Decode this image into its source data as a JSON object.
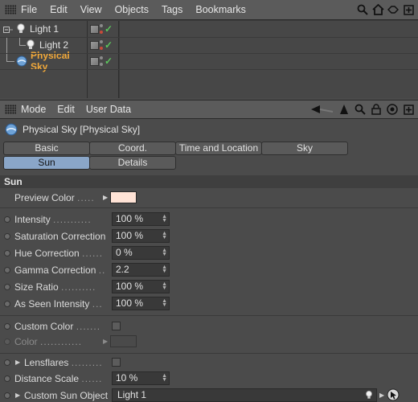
{
  "object_manager": {
    "menu": [
      "File",
      "Edit",
      "View",
      "Objects",
      "Tags",
      "Bookmarks"
    ],
    "objects": [
      {
        "name": "Light 1",
        "selected": false
      },
      {
        "name": "Light 2",
        "selected": false
      },
      {
        "name": "Physical Sky",
        "selected": true
      }
    ]
  },
  "attribute_manager": {
    "menu": [
      "Mode",
      "Edit",
      "User Data"
    ],
    "title": "Physical Sky [Physical Sky]",
    "tabs_row1": [
      "Basic",
      "Coord.",
      "Time and Location",
      "Sky"
    ],
    "tabs_row2": [
      "Sun",
      "Details"
    ],
    "active_tab": "Sun",
    "section": "Sun",
    "preview_color_label": "Preview Color",
    "preview_color": "#ffe3d6",
    "params": [
      {
        "label": "Intensity",
        "value": "100 %"
      },
      {
        "label": "Saturation Correction",
        "value": "100 %"
      },
      {
        "label": "Hue Correction",
        "value": "0 %"
      },
      {
        "label": "Gamma Correction",
        "value": "2.2"
      },
      {
        "label": "Size Ratio",
        "value": "100 %"
      },
      {
        "label": "As Seen Intensity",
        "value": "100 %"
      }
    ],
    "custom_color_label": "Custom Color",
    "color_label": "Color",
    "lensflares_label": "Lensflares",
    "distance_scale_label": "Distance Scale",
    "distance_scale_value": "10 %",
    "custom_sun_object_label": "Custom Sun Object",
    "custom_sun_object_value": "Light 1"
  },
  "colors": {
    "accent_selected": "#f2a93a",
    "active_tab": "#8aa6c8",
    "check_green": "#5cc45c"
  }
}
